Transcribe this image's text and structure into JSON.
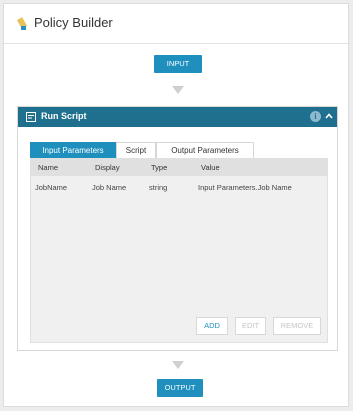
{
  "app": {
    "title": "Policy Builder"
  },
  "flow": {
    "input_label": "INPUT",
    "output_label": "OUTPUT"
  },
  "script_panel": {
    "title": "Run Script",
    "tabs": [
      "Input Parameters",
      "Script",
      "Output Parameters"
    ],
    "active_tab": "Input Parameters",
    "columns": [
      "Name",
      "Display",
      "Type",
      "Value"
    ],
    "rows": [
      {
        "name": "JobName",
        "display": "Job Name",
        "type": "string",
        "value": "Input Parameters.Job Name"
      }
    ],
    "buttons": {
      "add": "ADD",
      "edit": "EDIT",
      "remove": "REMOVE"
    },
    "info_glyph": "i"
  },
  "colors": {
    "accent": "#1f8fbd",
    "panel_header": "#1f6f8f"
  }
}
